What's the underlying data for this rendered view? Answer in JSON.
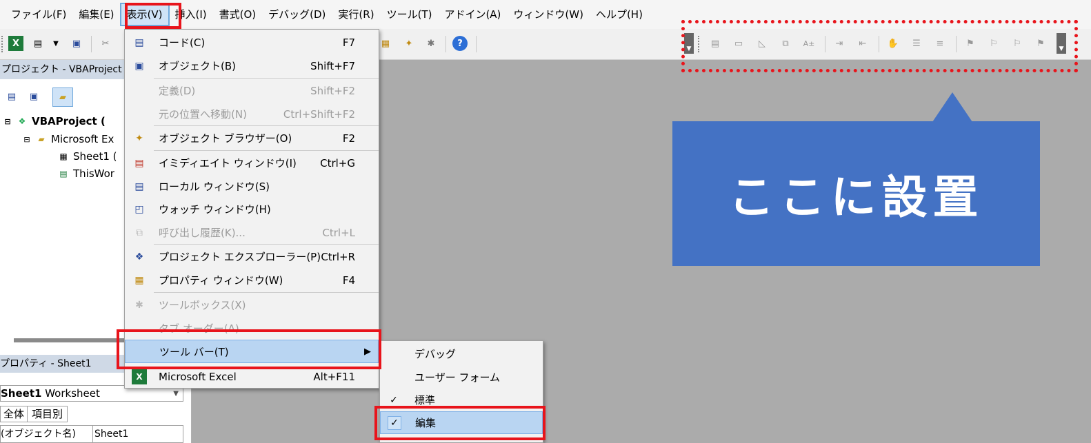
{
  "menubar": {
    "items": [
      "ファイル(F)",
      "編集(E)",
      "表示(V)",
      "挿入(I)",
      "書式(O)",
      "デバッグ(D)",
      "実行(R)",
      "ツール(T)",
      "アドイン(A)",
      "ウィンドウ(W)",
      "ヘルプ(H)"
    ],
    "active_index": 2
  },
  "project_pane": {
    "title": "プロジェクト - VBAProject",
    "nodes": [
      "VBAProject (",
      "Microsoft Ex",
      "Sheet1 (",
      "ThisWor"
    ]
  },
  "properties_pane": {
    "title": "プロパティ - Sheet1",
    "object_name": "Sheet1",
    "object_type": "Worksheet",
    "tabs": [
      "全体",
      "項目別"
    ],
    "row_name": "(オブジェクト名)",
    "row_value": "Sheet1"
  },
  "view_menu": {
    "items": [
      {
        "label": "コード(C)",
        "shortcut": "F7",
        "icon": "code-window-icon",
        "disabled": false
      },
      {
        "label": "オブジェクト(B)",
        "shortcut": "Shift+F7",
        "icon": "object-icon",
        "disabled": false
      },
      {
        "label": "定義(D)",
        "shortcut": "Shift+F2",
        "icon": "",
        "disabled": true
      },
      {
        "label": "元の位置へ移動(N)",
        "shortcut": "Ctrl+Shift+F2",
        "icon": "",
        "disabled": true
      },
      {
        "label": "オブジェクト ブラウザー(O)",
        "shortcut": "F2",
        "icon": "object-browser-icon",
        "disabled": false
      },
      {
        "label": "イミディエイト ウィンドウ(I)",
        "shortcut": "Ctrl+G",
        "icon": "immediate-window-icon",
        "disabled": false
      },
      {
        "label": "ローカル ウィンドウ(S)",
        "shortcut": "",
        "icon": "locals-window-icon",
        "disabled": false
      },
      {
        "label": "ウォッチ ウィンドウ(H)",
        "shortcut": "",
        "icon": "watch-window-icon",
        "disabled": false
      },
      {
        "label": "呼び出し履歴(K)...",
        "shortcut": "Ctrl+L",
        "icon": "call-stack-icon",
        "disabled": true
      },
      {
        "label": "プロジェクト エクスプローラー(P)",
        "shortcut": "Ctrl+R",
        "icon": "project-explorer-icon",
        "disabled": false
      },
      {
        "label": "プロパティ ウィンドウ(W)",
        "shortcut": "F4",
        "icon": "properties-window-icon",
        "disabled": false
      },
      {
        "label": "ツールボックス(X)",
        "shortcut": "",
        "icon": "toolbox-icon",
        "disabled": true
      },
      {
        "label": "タブ オーダー(A)",
        "shortcut": "",
        "icon": "",
        "disabled": true
      },
      {
        "label": "ツール バー(T)",
        "shortcut": "",
        "icon": "",
        "disabled": false,
        "highlighted": true
      },
      {
        "label": "Microsoft Excel",
        "shortcut": "Alt+F11",
        "icon": "excel-icon",
        "disabled": false
      }
    ]
  },
  "toolbar_submenu": {
    "items": [
      {
        "label": "デバッグ",
        "checked": false
      },
      {
        "label": "ユーザー フォーム",
        "checked": false
      },
      {
        "label": "標準",
        "checked": true
      },
      {
        "label": "編集",
        "checked": true,
        "highlighted": true
      }
    ],
    "check_glyph": "✓"
  },
  "callout": {
    "text": "ここに設置"
  },
  "colors": {
    "highlight_box": "#e8141b",
    "callout_bg": "#4472c4",
    "menu_highlight": "#b9d5f2",
    "workspace_bg": "#ababab"
  }
}
